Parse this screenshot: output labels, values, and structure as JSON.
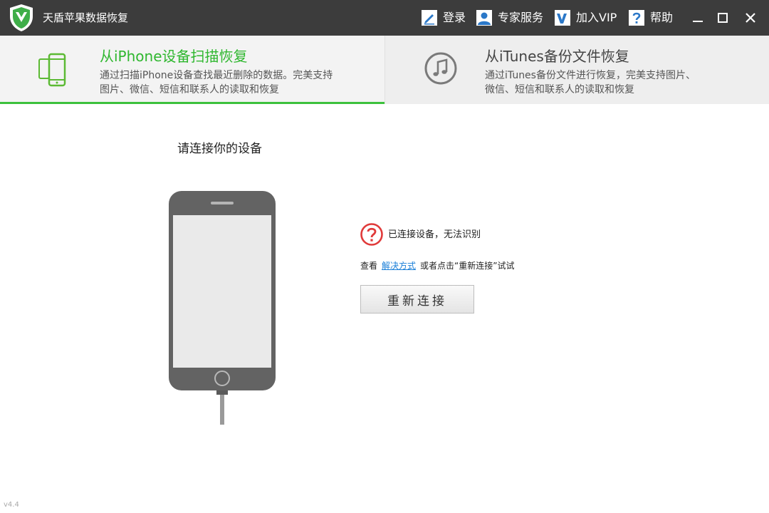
{
  "app": {
    "title": "天盾苹果数据恢复",
    "version": "v4.4"
  },
  "toolbar": {
    "login_label": "登录",
    "expert_label": "专家服务",
    "vip_label": "加入VIP",
    "help_label": "帮助"
  },
  "tabs": [
    {
      "title": "从iPhone设备扫描恢复",
      "desc": "通过扫描iPhone设备查找最近删除的数据。完美支持图片、微信、短信和联系人的读取和恢复",
      "active": true
    },
    {
      "title": "从iTunes备份文件恢复",
      "desc": "通过iTunes备份文件进行恢复，完美支持图片、微信、短信和联系人的读取和恢复",
      "active": false
    }
  ],
  "main": {
    "heading": "请连接你的设备",
    "status": "已连接设备，无法识别",
    "hint_prefix": "查看",
    "hint_link": "解决方式",
    "hint_suffix": "或者点击“重新连接”试试",
    "reconnect_label": "重新连接"
  },
  "colors": {
    "titlebar": "#3c3c3c",
    "accent_green": "#3cc13c",
    "link_blue": "#1a7fd8",
    "error_red": "#e03a3a",
    "phone_gray": "#636363"
  }
}
